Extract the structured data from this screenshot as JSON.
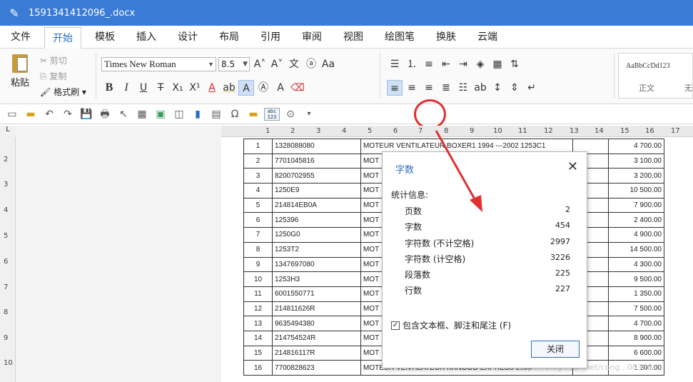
{
  "window": {
    "title": "1591341412096_.docx"
  },
  "menu": {
    "tabs": [
      "文件",
      "开始",
      "模板",
      "插入",
      "设计",
      "布局",
      "引用",
      "审阅",
      "视图",
      "绘图笔",
      "换肤",
      "云端"
    ]
  },
  "ribbon": {
    "paste_label": "粘贴",
    "cut_label": "剪切",
    "copy_label": "复制",
    "format_painter_label": "格式刷",
    "font_name": "Times New Roman",
    "font_size": "8.5",
    "style_sample": "AaBbCcDd123",
    "style_name_1": "正文",
    "style_name_2": "无"
  },
  "ruler": {
    "h": [
      "1",
      "2",
      "3",
      "4",
      "5",
      "6",
      "7",
      "8",
      "9",
      "10",
      "11",
      "12",
      "13",
      "14",
      "15",
      "16",
      "17"
    ],
    "v": [
      "2",
      "3",
      "4",
      "5",
      "6",
      "7",
      "8",
      "9",
      "10"
    ],
    "corner": "L"
  },
  "table": {
    "rows": [
      [
        "1",
        "1328088080",
        "MOTEUR VENTILATEUR BOXER1 1994 ---2002 1253C1",
        "",
        "4 700.00"
      ],
      [
        "2",
        "7701045816",
        "MOT",
        "",
        "3 100.00"
      ],
      [
        "3",
        "8200702955",
        "MOT",
        "",
        "3 200.00"
      ],
      [
        "4",
        "1250E9",
        "MOT",
        "",
        "10 500.00"
      ],
      [
        "5",
        "214814EB0A",
        "MOT",
        "",
        "7 900.00"
      ],
      [
        "6",
        "125396",
        "MOT",
        "",
        "2 400.00"
      ],
      [
        "7",
        "1250G0",
        "MOT",
        "",
        "4 900.00"
      ],
      [
        "8",
        "1253T2",
        "MOT",
        "",
        "14 500.00"
      ],
      [
        "9",
        "1347697080",
        "MOT",
        "",
        "4 300.00"
      ],
      [
        "10",
        "1253H3",
        "MOT",
        "",
        "9 500.00"
      ],
      [
        "11",
        "6001550771",
        "MOT",
        "",
        "1 350.00"
      ],
      [
        "12",
        "214811626R",
        "MOT",
        "",
        "7 500.00"
      ],
      [
        "13",
        "9635494380",
        "MOT",
        "",
        "4 700.00"
      ],
      [
        "14",
        "214754524R",
        "MOT",
        "",
        "8 900.00"
      ],
      [
        "15",
        "214816117R",
        "MOT",
        "",
        "6 600.00"
      ],
      [
        "16",
        "7700828623",
        "MOTEUR VENTILATEUR KANGOO EXPRESS 2008",
        "",
        "1 200.00"
      ]
    ]
  },
  "dialog": {
    "title": "字数",
    "subtitle": "统计信息:",
    "stats": [
      {
        "label": "页数",
        "value": "2"
      },
      {
        "label": "字数",
        "value": "454"
      },
      {
        "label": "字符数 (不计空格)",
        "value": "2997"
      },
      {
        "label": "字符数 (计空格)",
        "value": "3226"
      },
      {
        "label": "段落数",
        "value": "225"
      },
      {
        "label": "行数",
        "value": "227"
      }
    ],
    "checkbox_label": "包含文本框、脚注和尾注 (F)",
    "checkbox_checked": true,
    "close_label": "关闭"
  },
  "watermark": "https://blog.csdn.net/cong...00306",
  "colors": {
    "titlebar": "#3a7bd5",
    "accent": "#2a6cc4",
    "annotation": "#e03030"
  }
}
